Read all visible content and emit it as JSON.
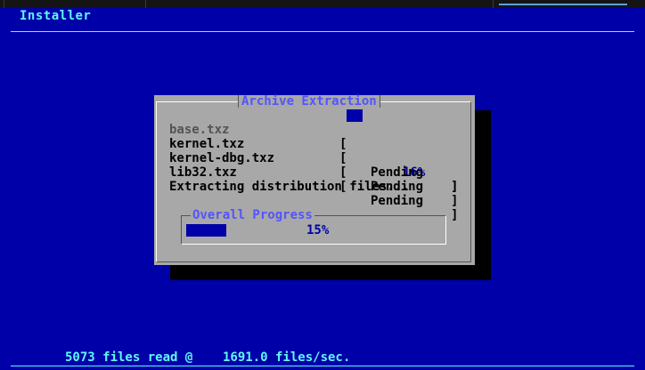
{
  "app": {
    "title": "Installer"
  },
  "dialog": {
    "title": "Archive Extraction",
    "files": [
      {
        "name": "base.txz",
        "state": "in-progress",
        "progress_fraction": 0.16,
        "percent_label": "16%"
      },
      {
        "name": "kernel.txz",
        "state": "pending",
        "status": "Pending"
      },
      {
        "name": "kernel-dbg.txz",
        "state": "pending",
        "status": "Pending"
      },
      {
        "name": "lib32.txz",
        "state": "pending",
        "status": "Pending"
      }
    ],
    "message": "Extracting distribution files...",
    "overall": {
      "label": "Overall Progress",
      "progress_fraction": 0.15,
      "percent_label": "15%"
    }
  },
  "status_bar": {
    "text": "5073 files read @    1691.0 files/sec."
  },
  "colors": {
    "screen_background": "#0000a8",
    "dialog_background": "#a8a8a8",
    "accent_cyan": "#5ff7f7",
    "title_blue": "#5454fc",
    "progress_fill": "#0000a8"
  }
}
